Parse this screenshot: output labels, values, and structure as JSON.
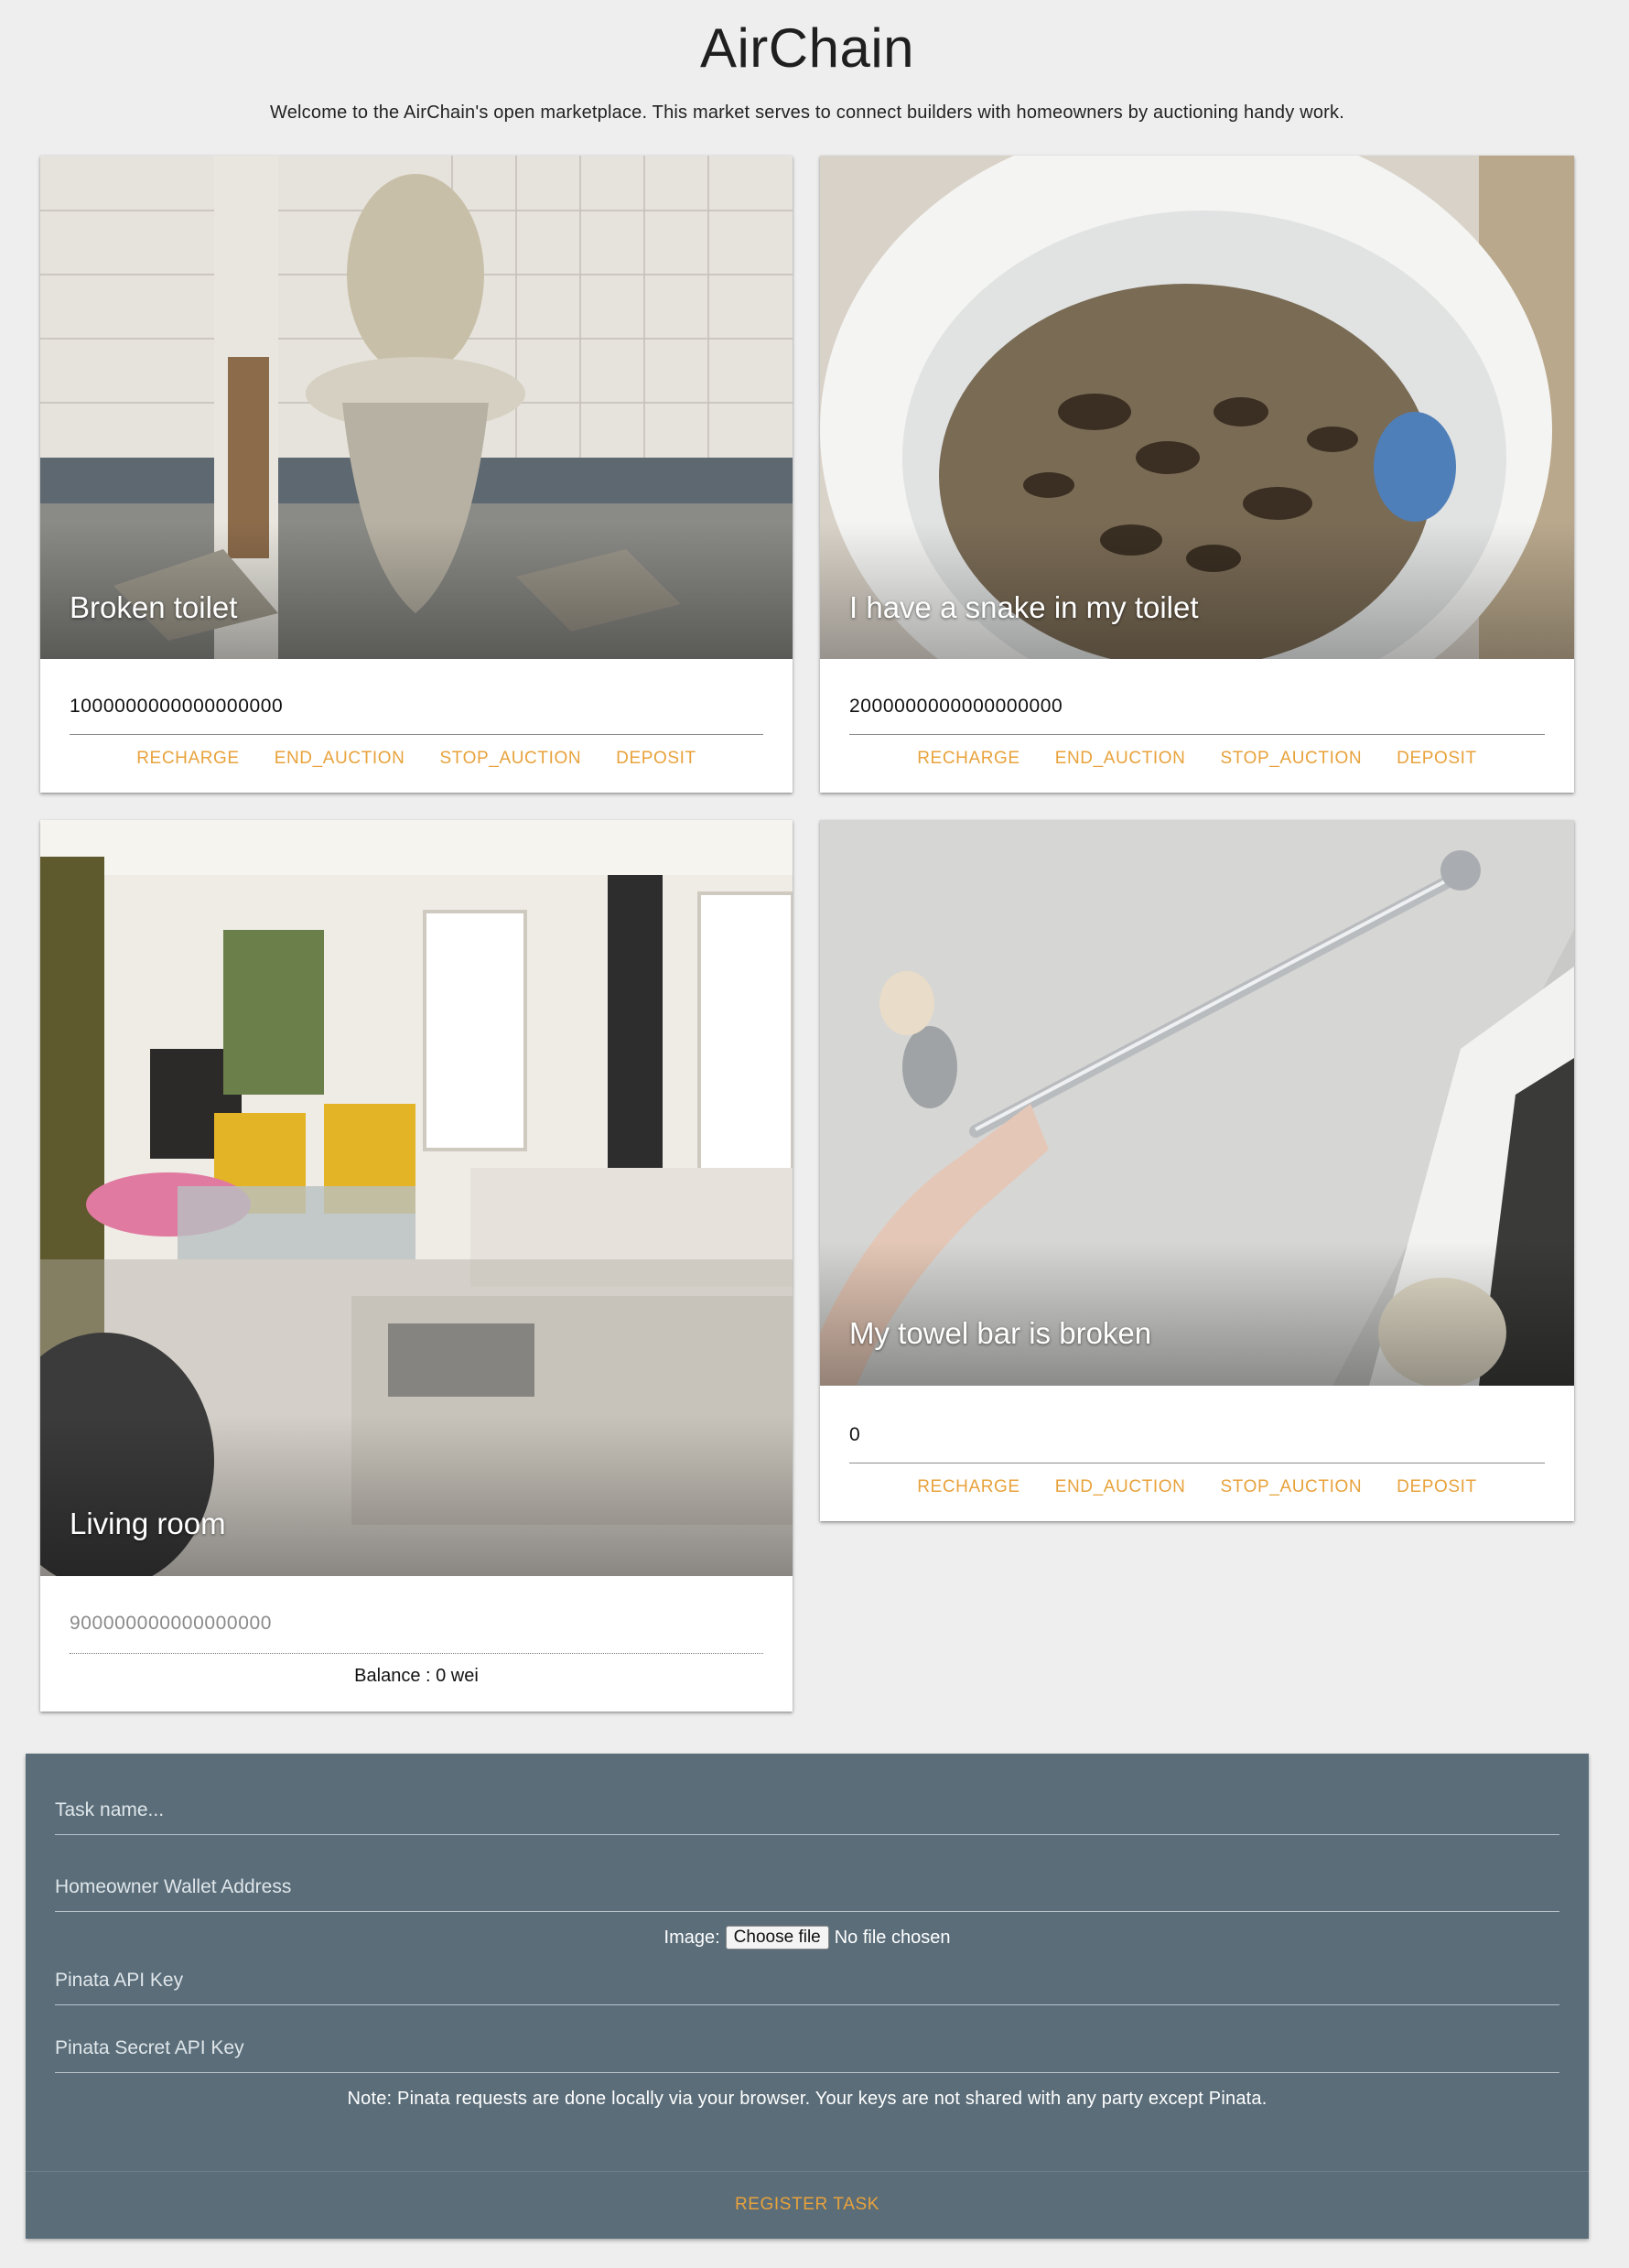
{
  "header": {
    "title": "AirChain",
    "subtitle": "Welcome to the AirChain's open marketplace. This market serves to connect builders with homeowners by auctioning handy work."
  },
  "cards": [
    {
      "caption": "Broken toilet",
      "value": "1000000000000000000",
      "actions": [
        "RECHARGE",
        "END_AUCTION",
        "STOP_AUCTION",
        "DEPOSIT"
      ]
    },
    {
      "caption": "I have a snake in my toilet",
      "value": "2000000000000000000",
      "actions": [
        "RECHARGE",
        "END_AUCTION",
        "STOP_AUCTION",
        "DEPOSIT"
      ]
    },
    {
      "caption": "Living room",
      "value_placeholder": "900000000000000000",
      "balance": "Balance : 0 wei"
    },
    {
      "caption": "My towel bar is broken",
      "value": "0",
      "actions": [
        "RECHARGE",
        "END_AUCTION",
        "STOP_AUCTION",
        "DEPOSIT"
      ]
    }
  ],
  "form": {
    "task_name_placeholder": "Task name...",
    "wallet_placeholder": "Homeowner Wallet Address",
    "image_label": "Image:",
    "choose_file": "Choose file",
    "no_file": "No file chosen",
    "api_key_placeholder": "Pinata API Key",
    "secret_key_placeholder": "Pinata Secret API Key",
    "note": "Note: Pinata requests are done locally via your browser. Your keys are not shared with any party except Pinata.",
    "register_label": "REGISTER TASK"
  },
  "colors": {
    "accent": "#e8a23b",
    "form_bg": "#5a6d79",
    "page_bg": "#eeeeee"
  }
}
